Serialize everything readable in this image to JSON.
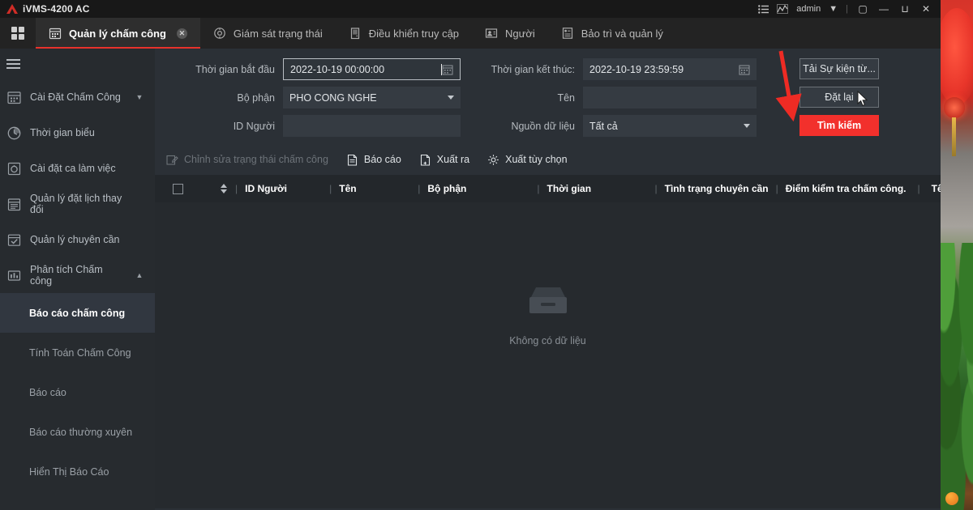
{
  "window": {
    "app_title": "iVMS-4200 AC",
    "logo_icon": "hik-logo-icon",
    "titlebar_icons": [
      "list-icon",
      "chart-icon"
    ],
    "user": "admin",
    "user_caret": "▼",
    "separator": "|",
    "restore_label": "▢",
    "minimize_label": "—",
    "maximize_label": "⊔",
    "close_label": "✕"
  },
  "tabs": {
    "grid_icon": "app-grid-icon",
    "items": [
      {
        "label": "Quản lý chấm công",
        "icon": "calendar-icon",
        "active": true,
        "closable": true,
        "close_label": "✕"
      },
      {
        "label": "Giám sát trạng thái",
        "icon": "monitor-status-icon",
        "active": false,
        "closable": false
      },
      {
        "label": "Điều khiển truy cập",
        "icon": "door-access-icon",
        "active": false,
        "closable": false
      },
      {
        "label": "Người",
        "icon": "person-icon",
        "active": false,
        "closable": false
      },
      {
        "label": "Bảo trì và quản lý",
        "icon": "maintenance-icon",
        "active": false,
        "closable": false
      }
    ]
  },
  "sidebar": {
    "hamburger_icon": "hamburger-icon",
    "items": [
      {
        "label": "Cài Đặt Chấm Công",
        "icon": "calendar-settings-icon",
        "caret": "▼",
        "expanded": false
      },
      {
        "label": "Thời gian biểu",
        "icon": "clock-icon",
        "caret": "",
        "expanded": false
      },
      {
        "label": "Cài đặt ca làm việc",
        "icon": "shift-settings-icon",
        "caret": "",
        "expanded": false
      },
      {
        "label": "Quản lý đặt lịch thay đổi",
        "icon": "schedule-clipboard-icon",
        "caret": "",
        "expanded": false
      },
      {
        "label": "Quản lý chuyên cần",
        "icon": "attendance-check-icon",
        "caret": "",
        "expanded": false
      },
      {
        "label": "Phân tích Chấm công",
        "icon": "analysis-chart-icon",
        "caret": "▲",
        "expanded": true
      }
    ],
    "sub_items": [
      {
        "label": "Báo cáo chấm công",
        "active": true
      },
      {
        "label": "Tính Toán Chấm Công",
        "active": false
      },
      {
        "label": "Báo cáo",
        "active": false
      },
      {
        "label": "Báo cáo thường xuyên",
        "active": false
      },
      {
        "label": "Hiển Thị Báo Cáo",
        "active": false
      }
    ]
  },
  "filters": {
    "start_time": {
      "label": "Thời gian bắt đầu",
      "value": "2022-10-19 00:00:00",
      "icon": "calendar-picker-icon",
      "focused": true
    },
    "department": {
      "label": "Bộ phận",
      "value": "PHO CONG NGHE",
      "icon": "chevron-down-icon"
    },
    "person_id": {
      "label": "ID Người",
      "value": "",
      "placeholder": ""
    },
    "end_time": {
      "label": "Thời gian kết thúc:",
      "value": "2022-10-19 23:59:59",
      "icon": "calendar-picker-icon"
    },
    "name": {
      "label": "Tên",
      "value": "",
      "placeholder": ""
    },
    "data_source": {
      "label": "Nguồn dữ liệu",
      "value": "Tất cả",
      "icon": "chevron-down-icon"
    },
    "buttons": [
      {
        "label": "Tải Sự kiện từ...",
        "style": "secondary"
      },
      {
        "label": "Đặt lại",
        "style": "secondary"
      },
      {
        "label": "Tìm kiếm",
        "style": "primary"
      }
    ]
  },
  "annotation": {
    "arrow_color": "#ee2b24",
    "cursor_icon": "mouse-pointer-icon"
  },
  "toolbar": {
    "items": [
      {
        "label": "Chỉnh sửa trạng thái chấm công",
        "icon": "edit-icon",
        "disabled": true
      },
      {
        "label": "Báo cáo",
        "icon": "report-doc-icon",
        "disabled": false
      },
      {
        "label": "Xuất ra",
        "icon": "export-icon",
        "disabled": false
      },
      {
        "label": "Xuất tùy chọn",
        "icon": "gear-icon",
        "disabled": false
      }
    ]
  },
  "table": {
    "select_all_checkbox": "",
    "sort_icon": "sort-updown-icon",
    "divider": "|",
    "columns": [
      "ID Người",
      "Tên",
      "Bộ phận",
      "Thời gian",
      "Tình trạng chuyên cần",
      "Điểm kiểm tra chấm công.",
      "Tên từ"
    ],
    "rows": [],
    "empty_state": {
      "icon": "empty-box-icon",
      "text": "Không có dữ liệu"
    }
  },
  "colors": {
    "accent_red": "#e8322b",
    "primary_button": "#f2302c",
    "panel_bg": "#2b3036",
    "sidebar_bg": "#272b2f",
    "table_bg": "#262a2e"
  }
}
